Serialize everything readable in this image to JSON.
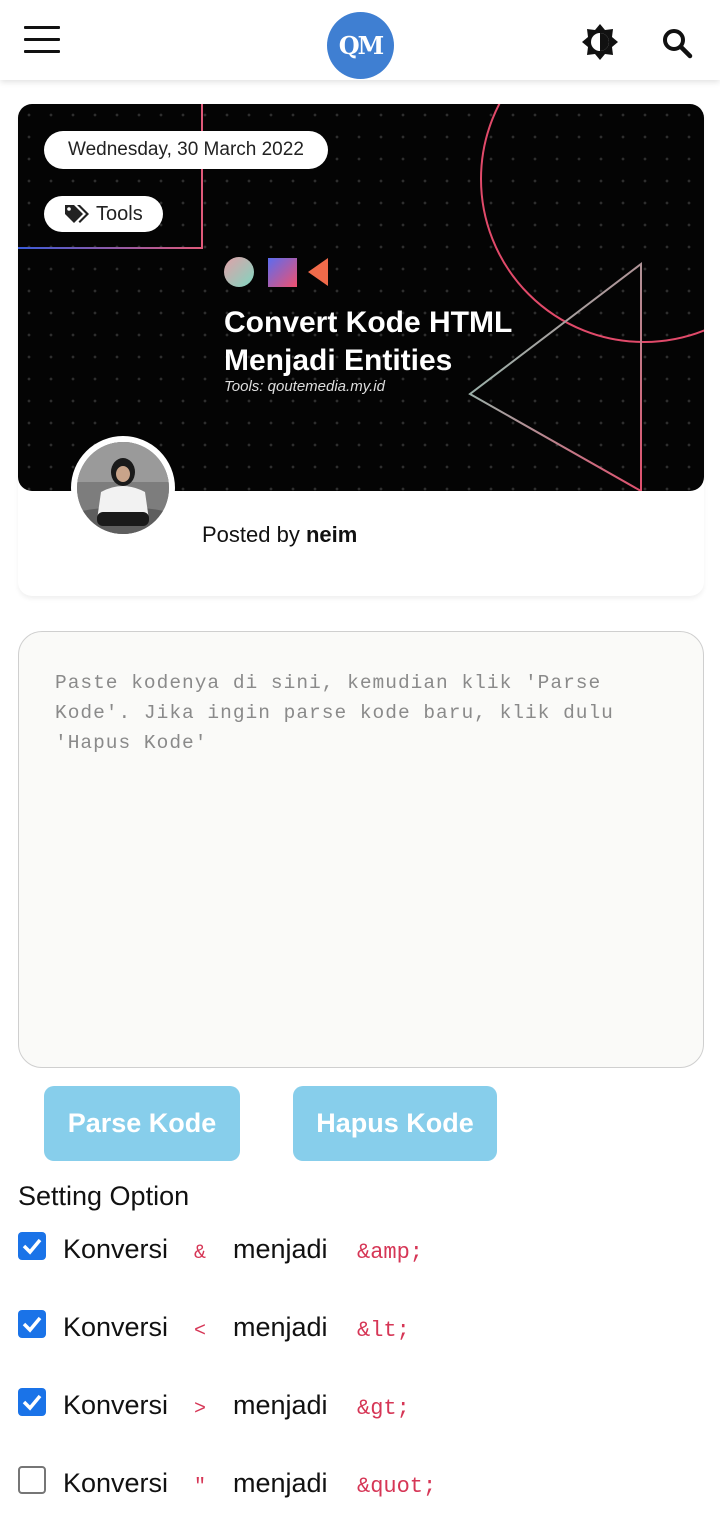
{
  "header": {
    "logo_text": "QM",
    "menu_icon": "hamburger-icon",
    "theme_icon": "brightness-icon",
    "search_icon": "search-icon"
  },
  "post": {
    "date": "Wednesday, 30 March 2022",
    "tag": "Tools",
    "tag_icon": "tags-icon",
    "banner_title_line1": "Convert Kode HTML",
    "banner_title_line2": "Menjadi Entities",
    "banner_subtitle": "Tools: qoutemedia.my.id",
    "posted_by_label": "Posted by",
    "author": "neim"
  },
  "editor": {
    "placeholder": "Paste kodenya di sini, kemudian klik 'Parse Kode'. Jika ingin parse kode baru, klik dulu 'Hapus Kode'",
    "value": ""
  },
  "buttons": {
    "parse": "Parse Kode",
    "clear": "Hapus Kode"
  },
  "settings": {
    "title": "Setting Option",
    "options": [
      {
        "label": "Konversi",
        "symbol": "&",
        "middle": "menjadi",
        "entity": "&amp;",
        "checked": true
      },
      {
        "label": "Konversi",
        "symbol": "<",
        "middle": "menjadi",
        "entity": "&lt;",
        "checked": true
      },
      {
        "label": "Konversi",
        "symbol": ">",
        "middle": "menjadi",
        "entity": "&gt;",
        "checked": true
      },
      {
        "label": "Konversi",
        "symbol": "\"",
        "middle": "menjadi",
        "entity": "&quot;",
        "checked": false
      }
    ]
  },
  "colors": {
    "accent": "#87ceeb",
    "logo": "#3f7fd2",
    "code": "#d63656",
    "checkbox": "#1a73e8"
  }
}
